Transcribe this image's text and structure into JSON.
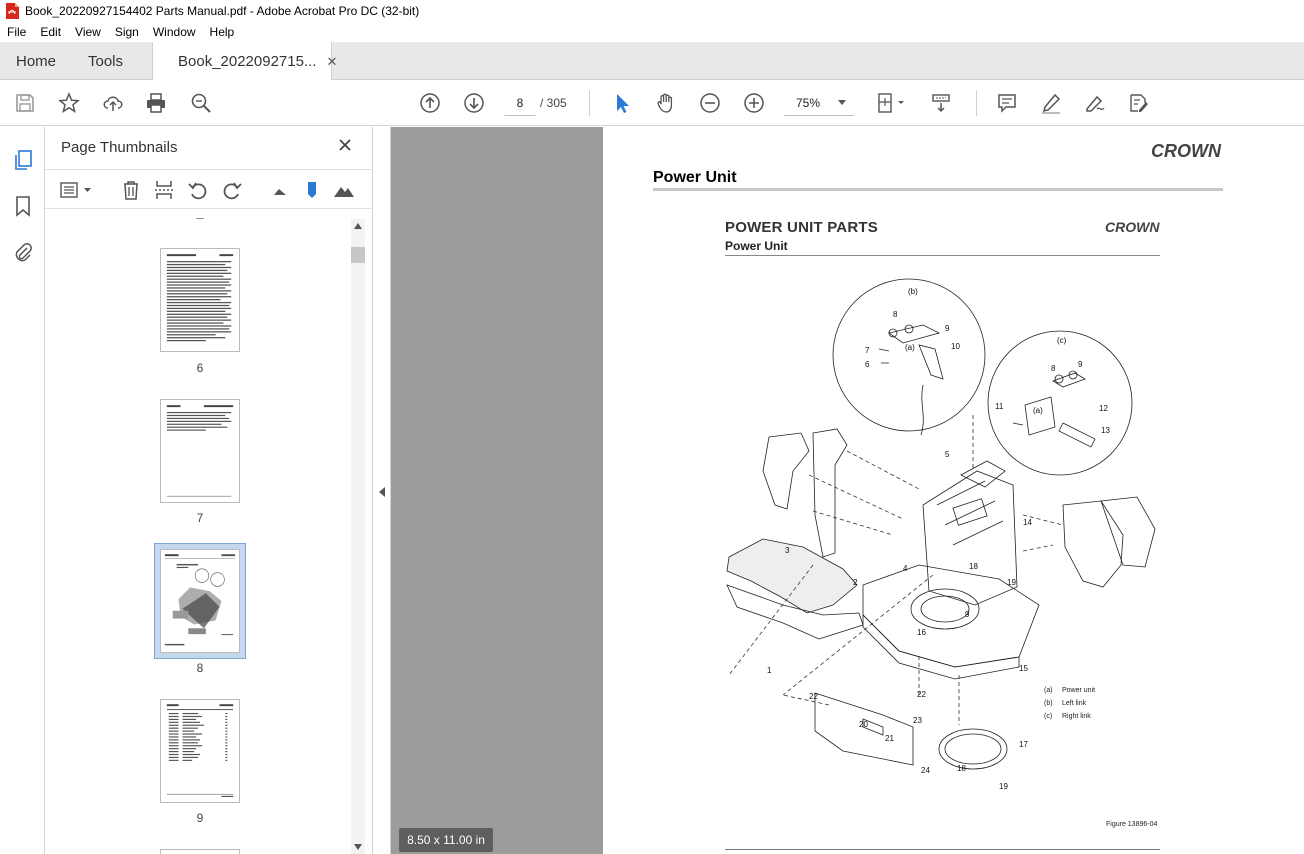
{
  "window": {
    "title": "Book_20220927154402 Parts Manual.pdf - Adobe Acrobat Pro DC (32-bit)"
  },
  "menu": [
    "File",
    "Edit",
    "View",
    "Sign",
    "Window",
    "Help"
  ],
  "tabs": {
    "home": "Home",
    "tools": "Tools",
    "document": "Book_2022092715..."
  },
  "nav": {
    "current_page": "8",
    "total_pages": "/ 305",
    "zoom": "75%"
  },
  "sidebar": {
    "panel_title": "Page Thumbnails",
    "thumbnails": [
      {
        "label": "6"
      },
      {
        "label": "7"
      },
      {
        "label": "8",
        "selected": true
      },
      {
        "label": "9"
      }
    ]
  },
  "status": {
    "page_size": "8.50 x 11.00 in"
  },
  "document": {
    "brand": "CROWN",
    "page_title": "Power Unit",
    "section_title": "POWER UNIT PARTS",
    "section_subtitle": "Power Unit",
    "figure_caption": "Figure 13896-04",
    "callouts": [
      "1",
      "2",
      "3",
      "4",
      "5",
      "6",
      "7",
      "8",
      "9",
      "10",
      "11",
      "12",
      "13",
      "14",
      "15",
      "16",
      "17",
      "18",
      "19",
      "20",
      "21",
      "22",
      "23",
      "24"
    ],
    "detail_labels": [
      "(a)",
      "(b)",
      "(c)"
    ],
    "legend": [
      {
        "key": "(a)",
        "text": "Power unit"
      },
      {
        "key": "(b)",
        "text": "Left link"
      },
      {
        "key": "(c)",
        "text": "Right link"
      }
    ]
  },
  "colors": {
    "tab_bar": "#e8e8e8",
    "doc_background": "#9c9c9c",
    "accent_blue": "#2a7ad3",
    "pdf_red": "#d9261c"
  },
  "icons": {
    "save": "save-icon",
    "bookmark_star": "star-icon",
    "upload": "upload-icon",
    "print": "print-icon",
    "find": "zoom-find-icon",
    "prev_page": "arrow-up-circle-icon",
    "next_page": "arrow-down-circle-icon",
    "select": "cursor-arrow-icon",
    "hand": "hand-icon",
    "zoom_out": "minus-circle-icon",
    "zoom_in": "plus-circle-icon"
  }
}
